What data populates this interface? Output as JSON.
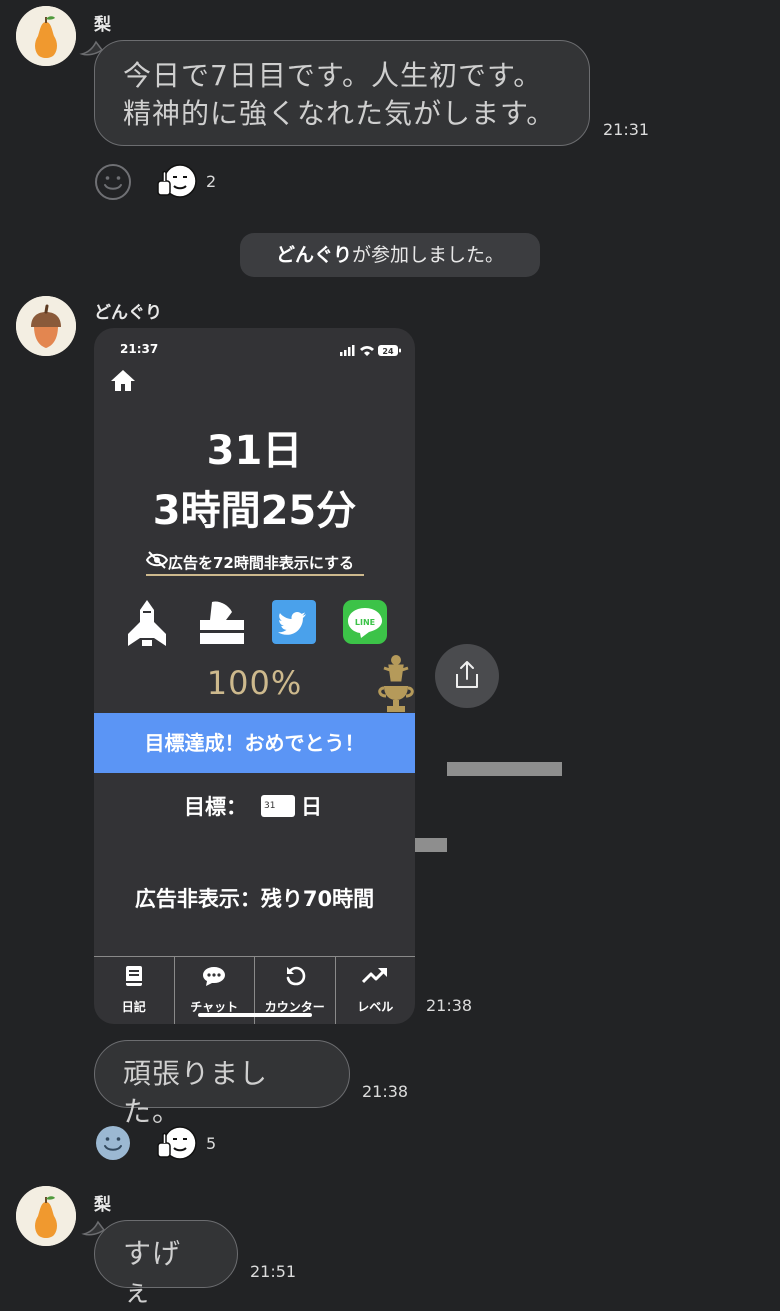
{
  "messages": [
    {
      "sender": "梨",
      "text": "今日で7日目です。人生初です。\n精神的に強くなれた気がします。",
      "time": "21:31",
      "reaction_count": "2"
    },
    {
      "system": true,
      "bold": "どんぐり",
      "rest": "が参加しました。"
    },
    {
      "sender": "どんぐり",
      "image_time": "21:38",
      "text": "頑張りました。",
      "time": "21:38",
      "reaction_count": "5"
    },
    {
      "sender": "梨",
      "text": "すげぇ",
      "time": "21:51"
    }
  ],
  "screenshot": {
    "status_time": "21:37",
    "battery": "24",
    "days": "31日",
    "hours_minutes": "3時間25分",
    "hide_ads_link": "広告を72時間非表示にする",
    "progress_percent": "100%",
    "banner": "目標達成！おめでとう！",
    "goal_label": "目標：",
    "goal_value": "31",
    "goal_unit": "日",
    "ads_remaining": "広告非表示：残り70時間",
    "line_label": "LINE",
    "tabs": [
      "日記",
      "チャット",
      "カウンター",
      "レベル"
    ]
  },
  "colors": {
    "background": "#222325",
    "bubble": "#333436",
    "banner": "#5b95f5",
    "progress_gold": "#cdb98d"
  }
}
